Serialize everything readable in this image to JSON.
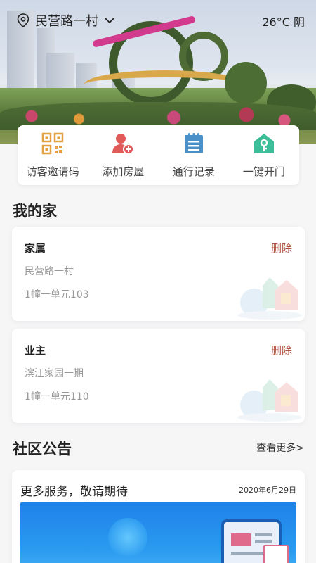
{
  "header": {
    "location": "民营路一村",
    "weather": "26°C 阴"
  },
  "quick_actions": [
    {
      "label": "访客邀请码",
      "icon": "qr-code-icon",
      "color": "#e3a03c"
    },
    {
      "label": "添加房屋",
      "icon": "add-person-icon",
      "color": "#e05a5a"
    },
    {
      "label": "通行记录",
      "icon": "notepad-icon",
      "color": "#4a90c8"
    },
    {
      "label": "一键开门",
      "icon": "home-key-icon",
      "color": "#3cbf98"
    }
  ],
  "my_home": {
    "title": "我的家",
    "cards": [
      {
        "role": "家属",
        "delete_label": "删除",
        "community": "民营路一村",
        "unit": "1幢一单元103"
      },
      {
        "role": "业主",
        "delete_label": "删除",
        "community": "滨江家园一期",
        "unit": "1幢一单元110"
      }
    ]
  },
  "notices": {
    "title": "社区公告",
    "more_label": "查看更多>",
    "items": [
      {
        "title": "更多服务，敬请期待",
        "date": "2020年6月29日"
      }
    ]
  },
  "colors": {
    "delete": "#b0503c",
    "accent_blue": "#2a9af0"
  }
}
